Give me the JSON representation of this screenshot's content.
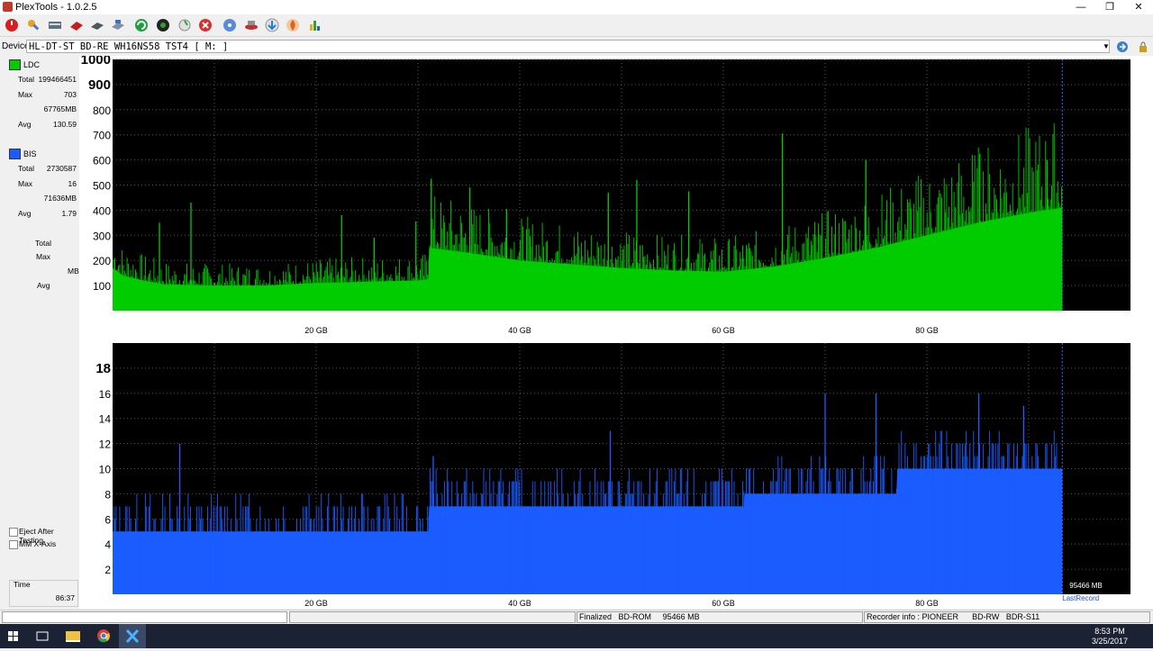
{
  "window": {
    "title": "PlexTools - 1.0.2.5"
  },
  "toolbar": {
    "icons": [
      "stop-icon",
      "tools-icon",
      "drive-icon",
      "red-disc-icon",
      "eject-icon",
      "scan-icon",
      "refresh-icon",
      "globe-icon",
      "recorder-icon",
      "cancel-icon",
      "disc-icon",
      "burn-icon",
      "download-icon",
      "fire-icon",
      "chart-icon"
    ]
  },
  "device": {
    "label": "Device:",
    "value": "HL-DT-ST BD-RE  WH16NS58  TST4 [ M: ]"
  },
  "left_panel": {
    "ldc": {
      "name": "LDC",
      "color": "#00cc00",
      "total_label": "Total",
      "total": "199466451",
      "max_label": "Max",
      "max": "703",
      "max_pos": "67765MB",
      "avg_label": "Avg",
      "avg": "130.59"
    },
    "bis": {
      "name": "BIS",
      "color": "#1a5cff",
      "total_label": "Total",
      "total": "2730587",
      "max_label": "Max",
      "max": "16",
      "max_pos": "71636MB",
      "avg_label": "Avg",
      "avg": "1.79"
    },
    "third": {
      "total_label": "Total",
      "max_label": "Max",
      "mb_label": "MB",
      "avg_label": "Avg"
    },
    "eject_after_testing": "Eject After Testing",
    "mm_x_axis": "MM X-Axis",
    "time_label": "Time",
    "time_value": "86:37"
  },
  "chart_data": [
    {
      "type": "area",
      "name": "LDC",
      "color": "#00cc00",
      "x_unit": "GB",
      "xlim": [
        0,
        100
      ],
      "ylim": [
        0,
        1000
      ],
      "x_ticks": [
        20,
        40,
        60,
        80
      ],
      "x_tick_labels": [
        "20 GB",
        "40 GB",
        "60 GB",
        "80 GB"
      ],
      "y_ticks": [
        100,
        200,
        300,
        400,
        500,
        600,
        700,
        800,
        900,
        1000
      ],
      "y_tick_labels": [
        "100",
        "200",
        "300",
        "400",
        "500",
        "600",
        "700",
        "800",
        "900",
        "1000"
      ],
      "grid": true,
      "baseline": {
        "x": [
          0,
          1,
          3,
          5,
          10,
          15,
          20,
          25,
          30,
          31,
          31.1,
          35,
          40,
          45,
          50,
          55,
          60,
          65,
          70,
          75,
          80,
          85,
          90,
          93.3
        ],
        "y": [
          170,
          140,
          120,
          105,
          100,
          100,
          110,
          115,
          120,
          125,
          250,
          230,
          200,
          185,
          170,
          160,
          155,
          175,
          210,
          250,
          300,
          350,
          390,
          410
        ]
      },
      "spikes": [
        {
          "x": 4.6,
          "y": 350
        },
        {
          "x": 7.7,
          "y": 430
        },
        {
          "x": 22.5,
          "y": 380
        },
        {
          "x": 25.7,
          "y": 290
        },
        {
          "x": 29.8,
          "y": 355
        },
        {
          "x": 31.3,
          "y": 525
        },
        {
          "x": 35.1,
          "y": 490
        },
        {
          "x": 38.7,
          "y": 405
        },
        {
          "x": 48.7,
          "y": 470
        },
        {
          "x": 51.5,
          "y": 520
        },
        {
          "x": 56.6,
          "y": 475
        },
        {
          "x": 65.8,
          "y": 705
        },
        {
          "x": 74.0,
          "y": 600
        },
        {
          "x": 85.2,
          "y": 625
        },
        {
          "x": 91.8,
          "y": 600
        }
      ],
      "end_marker": 93.3
    },
    {
      "type": "area",
      "name": "BIS",
      "color": "#1a5cff",
      "x_unit": "GB",
      "xlim": [
        0,
        100
      ],
      "ylim": [
        0,
        20
      ],
      "x_ticks": [
        20,
        40,
        60,
        80
      ],
      "x_tick_labels": [
        "20 GB",
        "40 GB",
        "60 GB",
        "80 GB"
      ],
      "y_ticks": [
        2,
        4,
        6,
        8,
        10,
        12,
        14,
        16,
        18
      ],
      "y_tick_labels": [
        "2",
        "4",
        "6",
        "8",
        "10",
        "12",
        "14",
        "16",
        "18"
      ],
      "grid": true,
      "baseline": {
        "x": [
          0,
          31,
          31.1,
          62,
          62.1,
          77,
          77.1,
          93.3
        ],
        "y": [
          5,
          5,
          7,
          7,
          8,
          8,
          10,
          10
        ]
      },
      "spikes": [
        {
          "x": 6.6,
          "y": 12
        },
        {
          "x": 31.5,
          "y": 11
        },
        {
          "x": 48.9,
          "y": 13
        },
        {
          "x": 70.0,
          "y": 16
        },
        {
          "x": 75.0,
          "y": 16
        },
        {
          "x": 85.1,
          "y": 16
        },
        {
          "x": 89.5,
          "y": 15
        }
      ],
      "end_marker": 93.3,
      "end_label": "95466 MB",
      "end_caption": "LastRecord"
    }
  ],
  "status": {
    "cell1": "",
    "cell2": "",
    "finalized": "Finalized",
    "disc_type": "BD-ROM",
    "size": "95466 MB",
    "recorder_info": "Recorder info : PIONEER",
    "rec_media": "BD-RW",
    "rec_model": "BDR-S11"
  },
  "taskbar": {
    "time": "8:53 PM",
    "date": "3/25/2017"
  }
}
